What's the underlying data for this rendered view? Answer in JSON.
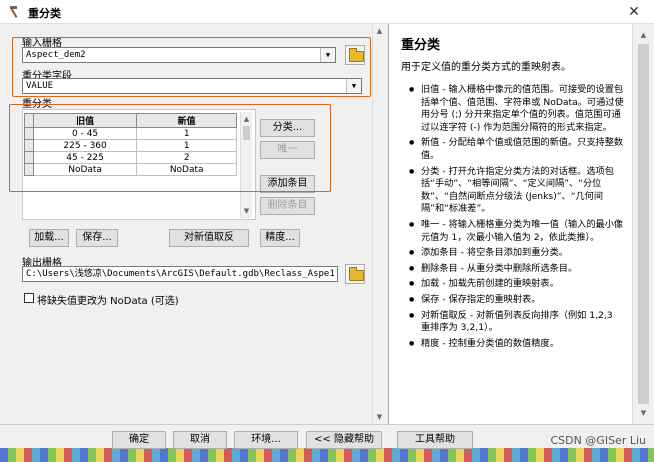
{
  "window": {
    "title": "重分类"
  },
  "input_raster": {
    "label": "输入栅格",
    "value": "Aspect_dem2"
  },
  "reclass_field": {
    "label": "重分类字段",
    "value": "VALUE"
  },
  "reclass_group": {
    "label": "重分类",
    "table": {
      "headers": [
        "旧值",
        "新值"
      ],
      "rows": [
        {
          "old": "0 - 45",
          "new": "1"
        },
        {
          "old": "225 - 360",
          "new": "1"
        },
        {
          "old": "45 - 225",
          "new": "2"
        },
        {
          "old": "NoData",
          "new": "NoData"
        }
      ]
    },
    "side_buttons": {
      "classify": "分类...",
      "unique": "唯一",
      "add_entry": "添加条目",
      "delete_entry": "删除条目"
    },
    "bottom_buttons": {
      "load": "加载...",
      "save": "保存...",
      "reverse": "对新值取反",
      "precision": "精度..."
    }
  },
  "output_raster": {
    "label": "输出栅格",
    "value": "C:\\Users\\浅悠凉\\Documents\\ArcGIS\\Default.gdb\\Reclass_Aspe1"
  },
  "nodata_option": {
    "label": "将缺失值更改为 NoData (可选)",
    "checked": false
  },
  "help": {
    "title": "重分类",
    "description": "用于定义值的重分类方式的重映射表。",
    "items": [
      "旧值 - 输入栅格中像元的值范围。可接受的设置包括单个值、值范围、字符串或 NoData。可通过使用分号 (;) 分开来指定单个值的列表。值范围可通过以连字符 (-) 作为范围分隔符的形式来指定。",
      "新值 - 分配给单个值或值范围的新值。只支持整数值。",
      "分类 - 打开允许指定分类方法的对话框。选项包括“手动”、“相等间隔”、“定义间隔”、“分位数”、“自然间断点分级法 (Jenks)”、“几何间隔”和“标准差”。",
      "唯一 - 将输入栅格重分类为唯一值（输入的最小像元值为 1，次最小输入值为 2，依此类推）。",
      "添加条目 - 将空条目添加到重分类。",
      "删除条目 - 从重分类中删除所选条目。",
      "加载 - 加载先前创建的重映射表。",
      "保存 - 保存指定的重映射表。",
      "对新值取反 - 对新值列表反向排序（例如 1,2,3 重排序为 3,2,1）。",
      "精度 - 控制重分类值的数值精度。"
    ]
  },
  "footer_buttons": {
    "ok": "确定",
    "cancel": "取消",
    "env": "环境...",
    "hide_help": "<< 隐藏帮助",
    "tool_help": "工具帮助"
  },
  "watermark": "CSDN @GISer Liu",
  "colors": {
    "annotation_box": "#d2691e"
  }
}
